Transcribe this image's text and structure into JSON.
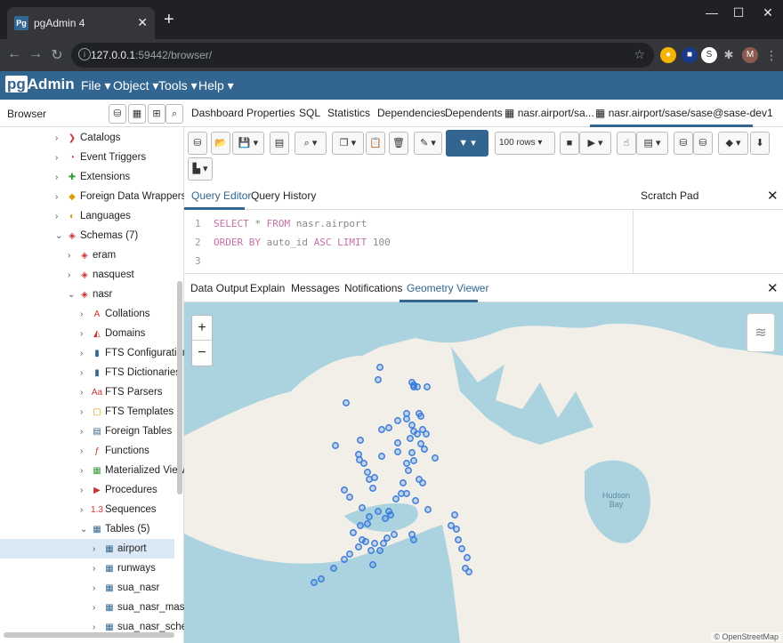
{
  "window": {
    "tab_title": "pgAdmin 4",
    "favicon": "Pg"
  },
  "address": {
    "url_host": "127.0.0.1",
    "url_rest": ":59442/browser/"
  },
  "extensions": [
    "M"
  ],
  "app": {
    "logo_pg": "pg",
    "logo_rest": "Admin",
    "menus": [
      "File",
      "Object",
      "Tools",
      "Help"
    ]
  },
  "browser": {
    "title": "Browser",
    "tree": [
      {
        "label": "Catalogs",
        "icon": "catalog-icon"
      },
      {
        "label": "Event Triggers",
        "icon": "event-trigger-icon"
      },
      {
        "label": "Extensions",
        "icon": "extension-icon"
      },
      {
        "label": "Foreign Data Wrappers",
        "icon": "fdw-icon"
      },
      {
        "label": "Languages",
        "icon": "language-icon"
      },
      {
        "label": "Schemas (7)",
        "icon": "schemas-icon"
      },
      {
        "label": "eram",
        "icon": "schema-icon"
      },
      {
        "label": "nasquest",
        "icon": "schema-icon"
      },
      {
        "label": "nasr",
        "icon": "schema-icon"
      },
      {
        "label": "Collations",
        "icon": "collation-icon"
      },
      {
        "label": "Domains",
        "icon": "domain-icon"
      },
      {
        "label": "FTS Configurations",
        "icon": "fts-config-icon"
      },
      {
        "label": "FTS Dictionaries",
        "icon": "fts-dict-icon"
      },
      {
        "label": "FTS Parsers",
        "icon": "fts-parser-icon"
      },
      {
        "label": "FTS Templates",
        "icon": "fts-template-icon"
      },
      {
        "label": "Foreign Tables",
        "icon": "foreign-table-icon"
      },
      {
        "label": "Functions",
        "icon": "function-icon"
      },
      {
        "label": "Materialized Views",
        "icon": "matview-icon"
      },
      {
        "label": "Procedures",
        "icon": "procedure-icon"
      },
      {
        "label": "Sequences",
        "icon": "sequence-icon"
      },
      {
        "label": "Tables (5)",
        "icon": "tables-icon"
      },
      {
        "label": "airport",
        "icon": "table-icon"
      },
      {
        "label": "runways",
        "icon": "table-icon"
      },
      {
        "label": "sua_nasr",
        "icon": "table-icon"
      },
      {
        "label": "sua_nasr_maste",
        "icon": "table-icon"
      },
      {
        "label": "sua_nasr_schedi",
        "icon": "table-icon"
      }
    ]
  },
  "panel_tabs": [
    "Dashboard",
    "Properties",
    "SQL",
    "Statistics",
    "Dependencies",
    "Dependents",
    "nasr.airport/sa...",
    "nasr.airport/sase/sase@sase-dev1"
  ],
  "toolbar": {
    "rows_select": "100 rows"
  },
  "query": {
    "tabs": [
      "Query Editor",
      "Query History"
    ],
    "scratch_title": "Scratch Pad",
    "lines": [
      {
        "n": "1",
        "kw1": "SELECT",
        "rest1": " * ",
        "kw2": "FROM",
        "rest2": " nasr.airport"
      },
      {
        "n": "2",
        "kw1": "ORDER BY",
        "rest1": " auto_id ",
        "kw2": "ASC LIMIT",
        "rest2": " 100"
      },
      {
        "n": "3",
        "kw1": "",
        "rest1": "",
        "kw2": "",
        "rest2": ""
      }
    ]
  },
  "output": {
    "tabs": [
      "Data Output",
      "Explain",
      "Messages",
      "Notifications",
      "Geometry Viewer"
    ]
  },
  "map": {
    "zoom_in": "+",
    "zoom_out": "−",
    "label_bay": "Hudson\nBay",
    "attribution": "© OpenStreetMap",
    "land_color": "#f2efe9",
    "water_color": "#aad3df",
    "marker_color": "#3b7ddd"
  }
}
